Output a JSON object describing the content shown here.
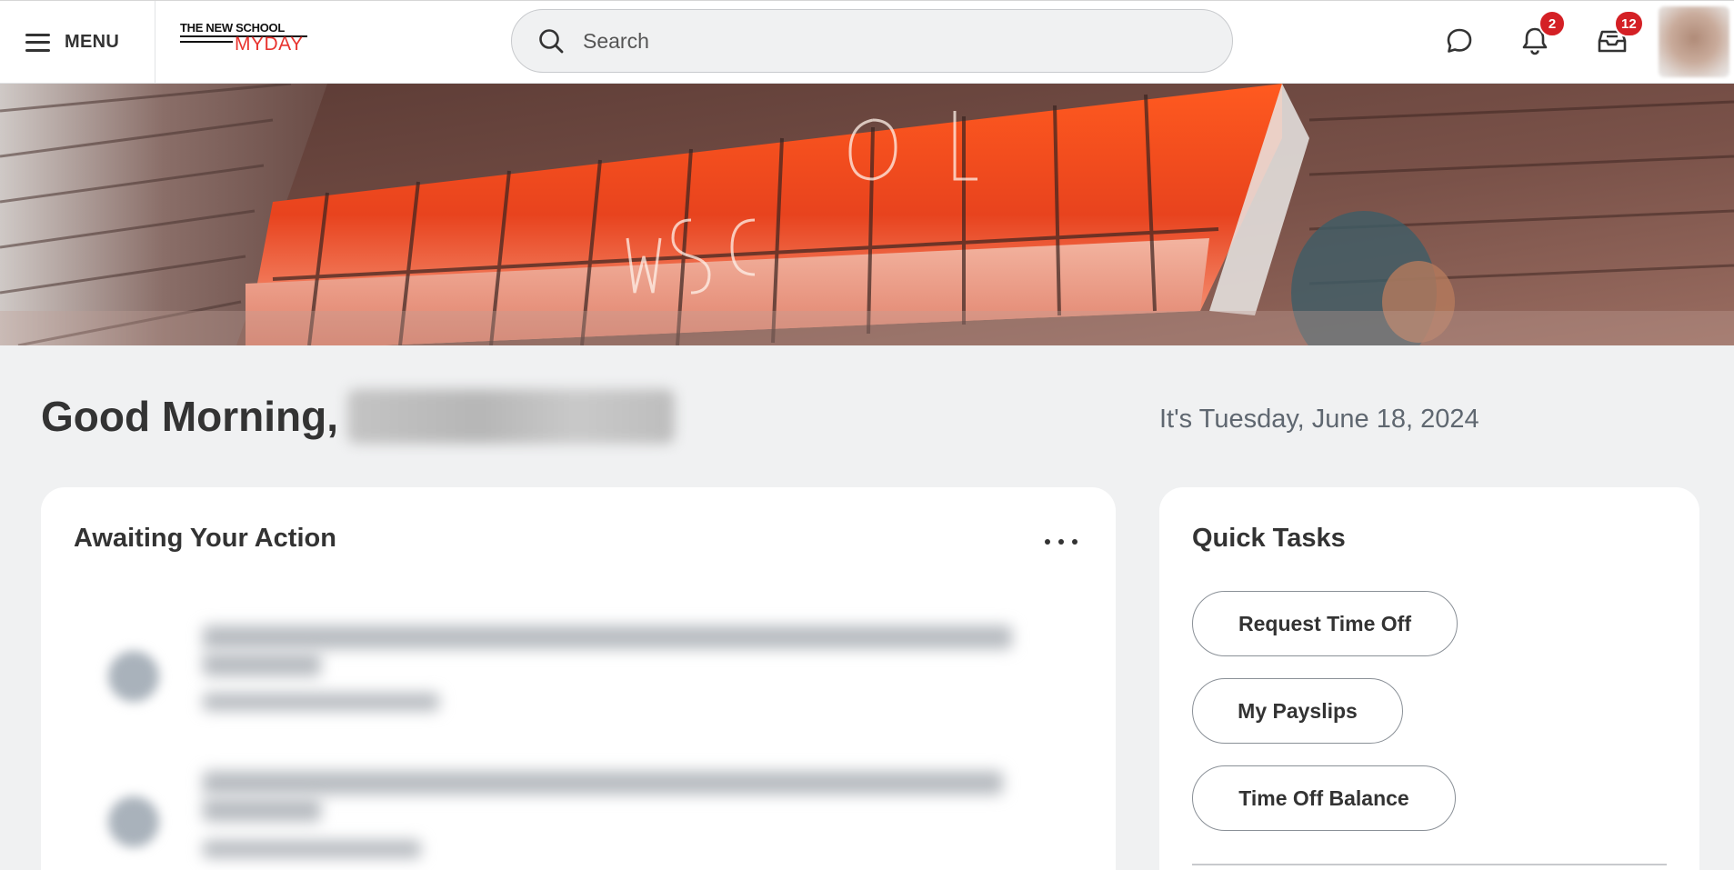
{
  "app": {
    "title": "Workday - The New School MyDay",
    "brand_line1": "THE NEW SCHOOL",
    "brand_line2": "MYDAY",
    "brand_color": "#e8342f"
  },
  "topbar": {
    "menu_label": "MENU",
    "menu_icon": "hamburger-icon",
    "search_placeholder": "Search",
    "search_icon": "search-icon",
    "chat_icon": "chat-bubble-icon",
    "notifications_icon": "bell-icon",
    "notifications_count": "2",
    "inbox_icon": "inbox-tray-icon",
    "inbox_count": "12",
    "badge_color": "#d42025"
  },
  "greeting": {
    "text": "Good Morning,",
    "date": "It's Tuesday, June 18, 2024"
  },
  "awaiting": {
    "title": "Awaiting Your Action",
    "more_icon": "more-horizontal-icon"
  },
  "quick_tasks": {
    "title": "Quick Tasks",
    "items": [
      {
        "label": "Request Time Off"
      },
      {
        "label": "My Payslips"
      },
      {
        "label": "Time Off Balance"
      }
    ]
  }
}
